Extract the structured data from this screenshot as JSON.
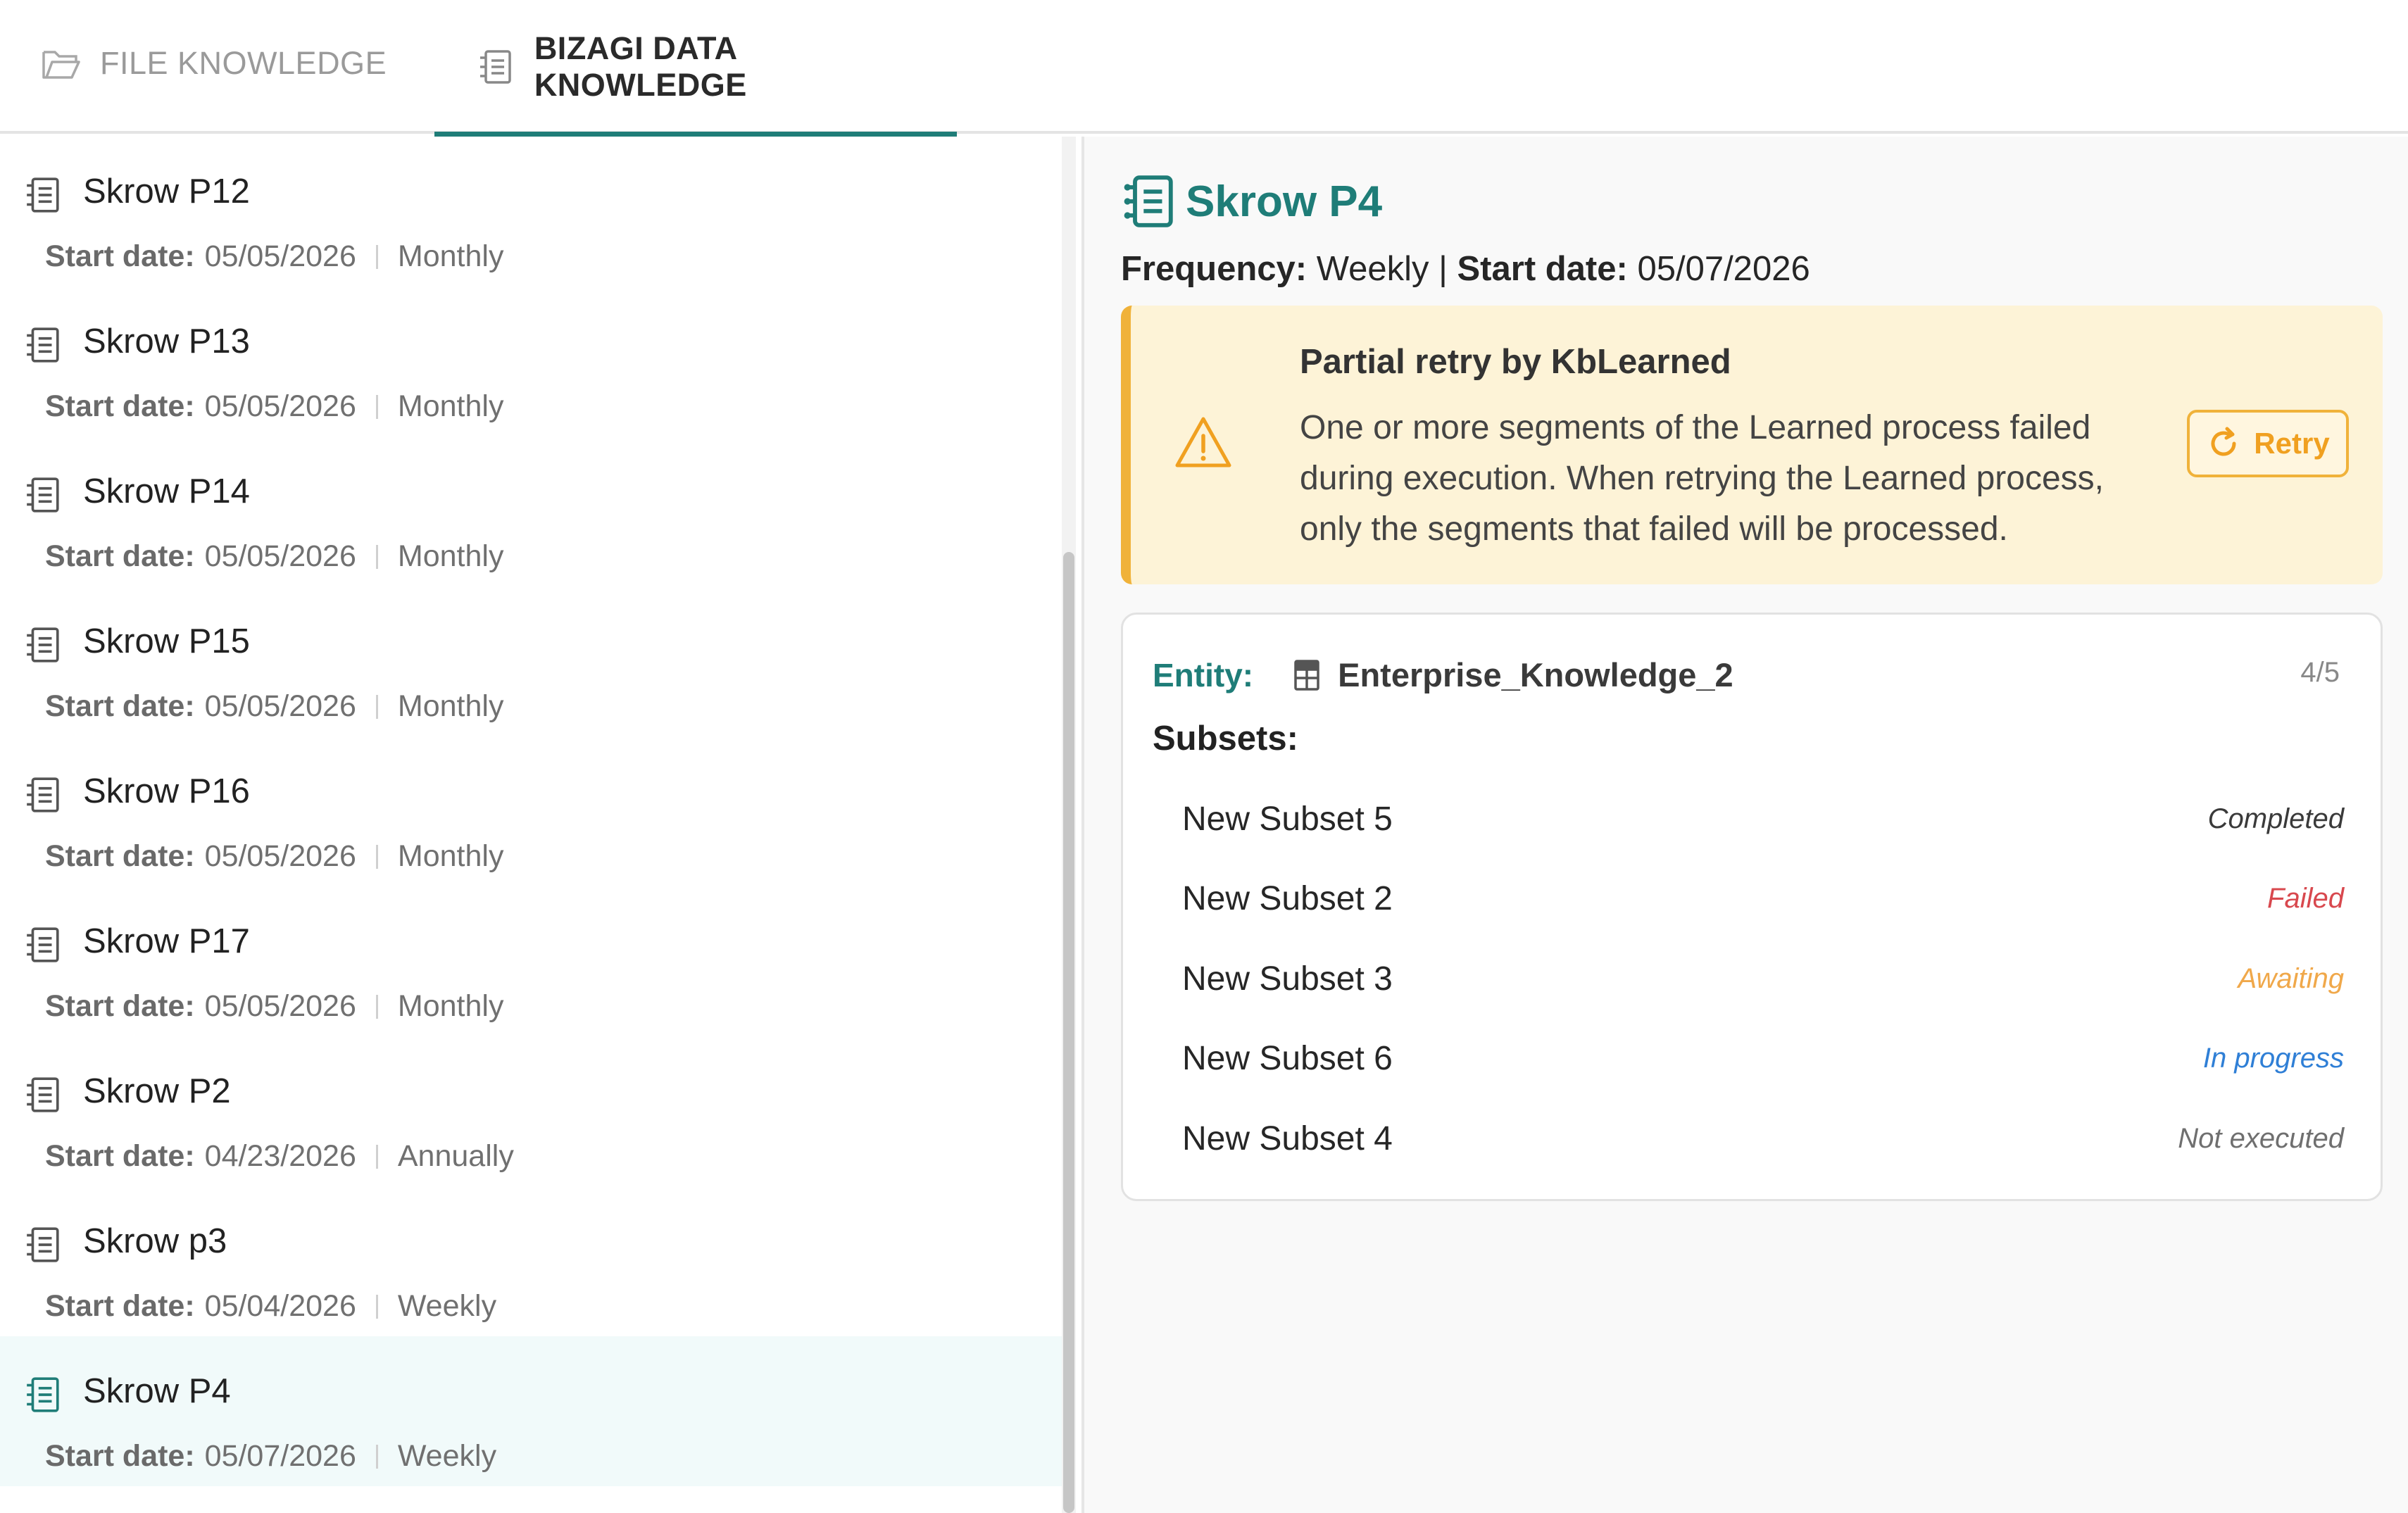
{
  "tabs": {
    "file": {
      "label": "FILE KNOWLEDGE",
      "icon": "folder-icon"
    },
    "bizagi": {
      "label": "BIZAGI DATA KNOWLEDGE",
      "icon": "data-list-icon"
    }
  },
  "list": {
    "start_key": "Start date:",
    "items": [
      {
        "title": "Skrow P12",
        "start_date": "05/05/2026",
        "frequency": "Monthly"
      },
      {
        "title": "Skrow P13",
        "start_date": "05/05/2026",
        "frequency": "Monthly"
      },
      {
        "title": "Skrow P14",
        "start_date": "05/05/2026",
        "frequency": "Monthly"
      },
      {
        "title": "Skrow P15",
        "start_date": "05/05/2026",
        "frequency": "Monthly"
      },
      {
        "title": "Skrow P16",
        "start_date": "05/05/2026",
        "frequency": "Monthly"
      },
      {
        "title": "Skrow P17",
        "start_date": "05/05/2026",
        "frequency": "Monthly"
      },
      {
        "title": "Skrow P2",
        "start_date": "04/23/2026",
        "frequency": "Annually"
      },
      {
        "title": "Skrow p3",
        "start_date": "05/04/2026",
        "frequency": "Weekly"
      },
      {
        "title": "Skrow P4",
        "start_date": "05/07/2026",
        "frequency": "Weekly"
      }
    ]
  },
  "detail": {
    "title": "Skrow P4",
    "frequency_key": "Frequency:",
    "frequency": "Weekly",
    "meta_sep": "|",
    "start_key": "Start date:",
    "start_date": "05/07/2026",
    "warning": {
      "title": "Partial retry by KbLearned",
      "text": "One or more segments of the Learned process failed during execution. When retrying the Learned process, only the segments that failed will be processed.",
      "retry_label": "Retry"
    },
    "entity": {
      "key": "Entity:",
      "value": "Enterprise_Knowledge_2",
      "count": "4/5",
      "subsets_label": "Subsets:",
      "subsets": [
        {
          "name": "New Subset 5",
          "status": "Completed"
        },
        {
          "name": "New Subset 2",
          "status": "Failed"
        },
        {
          "name": "New Subset 3",
          "status": "Awaiting"
        },
        {
          "name": "New Subset 6",
          "status": "In progress"
        },
        {
          "name": "New Subset 4",
          "status": "Not executed"
        }
      ]
    }
  },
  "colors": {
    "accent": "#1f7d78",
    "warning_border": "#f0b23a",
    "warning_bg": "#fdf3d7",
    "status_failed": "#d8484e",
    "status_awaiting": "#f0a84a",
    "status_in_progress": "#2f7fd6"
  }
}
